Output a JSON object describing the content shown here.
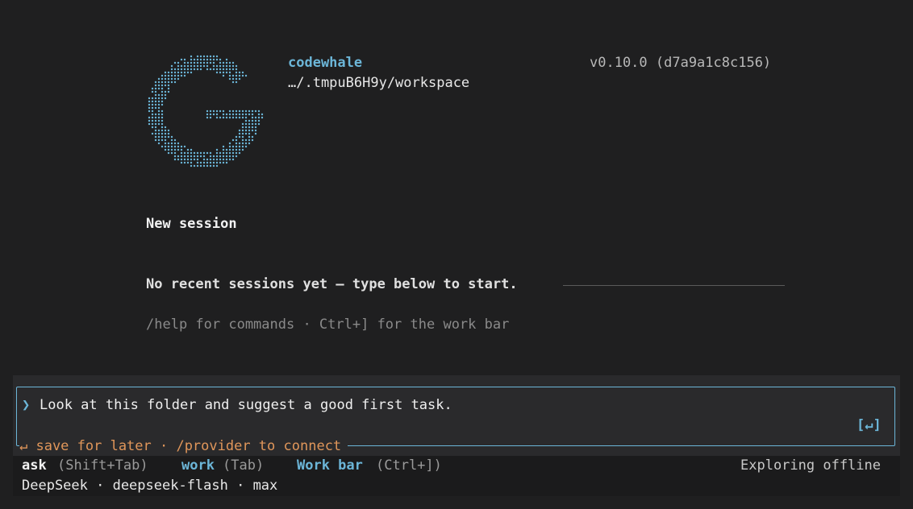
{
  "header": {
    "app_name": "codewhale",
    "path": "…/.tmpuB6H9y/workspace",
    "version": "v0.10.0 (d7a9a1c8c156)"
  },
  "main": {
    "new_session": "New session",
    "no_recent": "No recent sessions yet — type below to start.",
    "help_hint": "/help for commands · Ctrl+] for the work bar"
  },
  "input": {
    "chevron": "❯",
    "value": "Look at this folder and suggest a good first task.",
    "submit_label": "[↵]",
    "hint": "↵ save for later · /provider to connect"
  },
  "status": {
    "ask_label": "ask",
    "ask_key": "(Shift+Tab)",
    "work_label": "work",
    "work_key": "(Tab)",
    "bar_label": "Work bar",
    "bar_key": "(Ctrl+])",
    "right_text": "Exploring offline",
    "model_line": "DeepSeek · deepseek-flash · max"
  },
  "colors": {
    "accent": "#6cb6d8",
    "warning": "#e0965a",
    "background": "#1f1f20"
  },
  "icons": {
    "logo": "codewhale-dot-logo-icon"
  }
}
